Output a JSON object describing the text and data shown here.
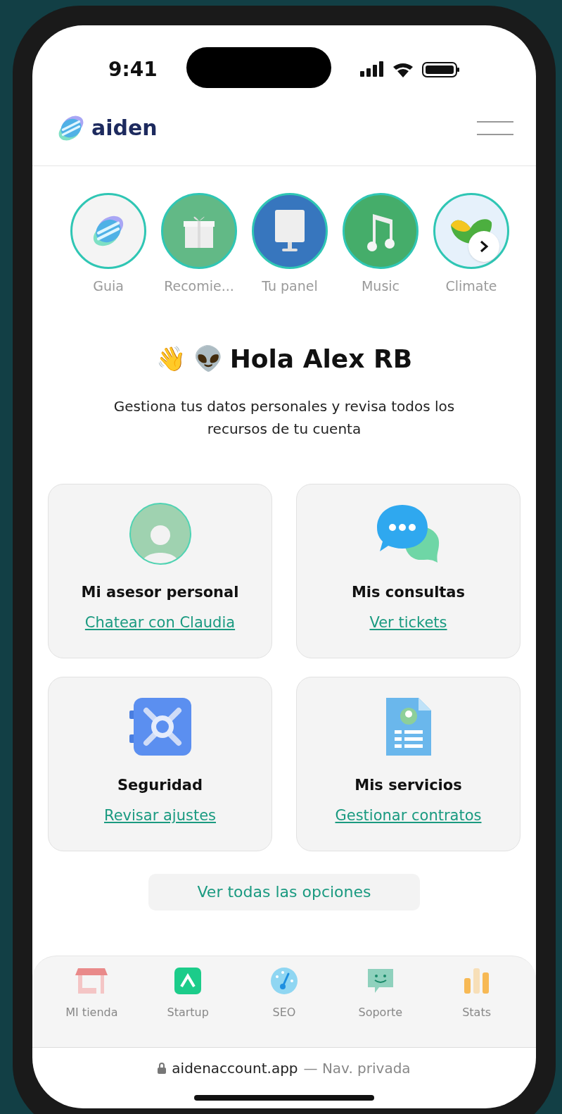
{
  "status_bar": {
    "time": "9:41"
  },
  "header": {
    "logo_text": "aiden"
  },
  "stories": [
    {
      "label": "Guia",
      "kind": "logo",
      "color": "#f4f4f4"
    },
    {
      "label": "Recomie...",
      "kind": "gift",
      "color": "#62b986"
    },
    {
      "label": "Tu panel",
      "kind": "monitor",
      "color": "#3776be"
    },
    {
      "label": "Music",
      "kind": "music",
      "color": "#45ad6a"
    },
    {
      "label": "Climate",
      "kind": "leaf",
      "color": "#e6f1fb"
    }
  ],
  "greeting": {
    "emoji": "👋 👽",
    "title": "Hola Alex RB",
    "subtitle": "Gestiona tus datos personales y revisa todos los recursos de tu cuenta"
  },
  "cards": [
    {
      "kind": "advisor",
      "title": "Mi asesor personal",
      "link": "Chatear con Claudia"
    },
    {
      "kind": "chat",
      "title": "Mis consultas",
      "link": "Ver tickets"
    },
    {
      "kind": "vault",
      "title": "Seguridad",
      "link": "Revisar ajustes"
    },
    {
      "kind": "document",
      "title": "Mis servicios",
      "link": "Gestionar contratos"
    }
  ],
  "all_options_button": "Ver todas las opciones",
  "bottom_nav": [
    {
      "kind": "store",
      "label": "MI tienda"
    },
    {
      "kind": "startup",
      "label": "Startup"
    },
    {
      "kind": "seo",
      "label": "SEO"
    },
    {
      "kind": "support",
      "label": "Soporte"
    },
    {
      "kind": "stats",
      "label": "Stats"
    }
  ],
  "browser_bar": {
    "domain": "aidenaccount.app",
    "suffix": "— Nav. privada"
  }
}
